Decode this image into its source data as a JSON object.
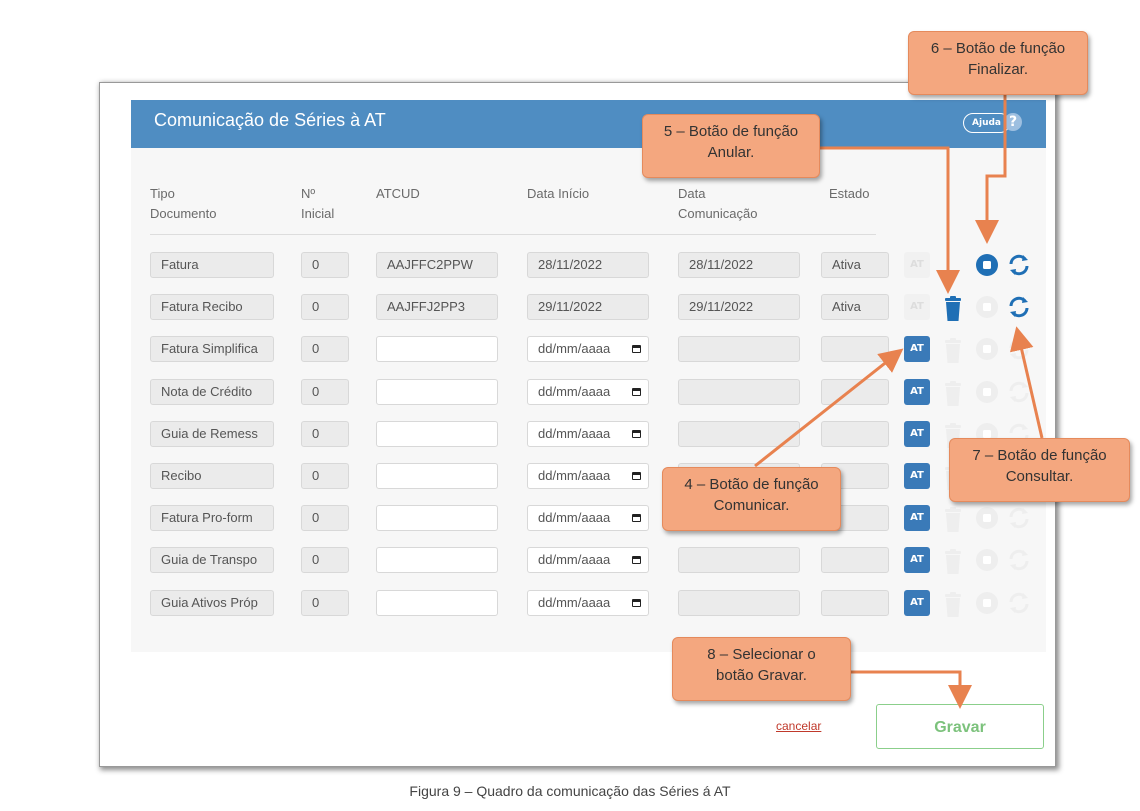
{
  "dialog": {
    "title": "Comunicação de Séries à AT",
    "help_label": "Ajuda",
    "help_icon": "?"
  },
  "columns": [
    "Tipo\nDocumento",
    "Nº\nInicial",
    "ATCUD",
    "Data Início",
    "Data\nComunicação",
    "Estado"
  ],
  "rows": [
    {
      "tipo": "Fatura",
      "inicial": "0",
      "atcud": "AAJFFC2PPW",
      "data_inicio": "28/11/2022",
      "data_com": "28/11/2022",
      "estado": "Ativa",
      "communicated": true,
      "icons": [
        "at-disabled",
        "trash-hidden",
        "stop-active",
        "refresh-active"
      ]
    },
    {
      "tipo": "Fatura Recibo",
      "inicial": "0",
      "atcud": "AAJFFJ2PP3",
      "data_inicio": "29/11/2022",
      "data_com": "29/11/2022",
      "estado": "Ativa",
      "communicated": true,
      "icons": [
        "at-disabled",
        "trash-active",
        "stop-disabled",
        "refresh-active"
      ]
    },
    {
      "tipo": "Fatura Simplifica",
      "inicial": "0",
      "atcud": "",
      "data_inicio": "dd/mm/aaaa",
      "data_com": "",
      "estado": "",
      "communicated": false
    },
    {
      "tipo": "Nota de Crédito",
      "inicial": "0",
      "atcud": "",
      "data_inicio": "dd/mm/aaaa",
      "data_com": "",
      "estado": "",
      "communicated": false
    },
    {
      "tipo": "Guia de Remess",
      "inicial": "0",
      "atcud": "",
      "data_inicio": "dd/mm/aaaa",
      "data_com": "",
      "estado": "",
      "communicated": false
    },
    {
      "tipo": "Recibo",
      "inicial": "0",
      "atcud": "",
      "data_inicio": "dd/mm/aaaa",
      "data_com": "",
      "estado": "",
      "communicated": false
    },
    {
      "tipo": "Fatura Pro-form",
      "inicial": "0",
      "atcud": "",
      "data_inicio": "dd/mm/aaaa",
      "data_com": "",
      "estado": "",
      "communicated": false
    },
    {
      "tipo": "Guia de Transpo",
      "inicial": "0",
      "atcud": "",
      "data_inicio": "dd/mm/aaaa",
      "data_com": "",
      "estado": "",
      "communicated": false
    },
    {
      "tipo": "Guia Ativos Próp",
      "inicial": "0",
      "atcud": "",
      "data_inicio": "dd/mm/aaaa",
      "data_com": "",
      "estado": "",
      "communicated": false
    }
  ],
  "footer": {
    "cancel_label": "cancelar",
    "save_label": "Gravar"
  },
  "callouts": {
    "finalizar": "6 – Botão de função\nFinalizar.",
    "anular": "5 – Botão de função\nAnular.",
    "consultar": "7 – Botão de função\nConsultar.",
    "comunicar": "4 – Botão de função\nComunicar.",
    "gravar": "8 – Selecionar o\nbotão Gravar."
  },
  "caption": "Figura 9 – Quadro da comunicação das Séries á AT",
  "colors": {
    "header": "#4f8dc2",
    "accent_blue": "#1f6fb5",
    "callout_fill": "#f4a77f",
    "callout_arrow": "#e8824f",
    "save_green": "#7cc27c",
    "cancel_red": "#c0392b"
  }
}
